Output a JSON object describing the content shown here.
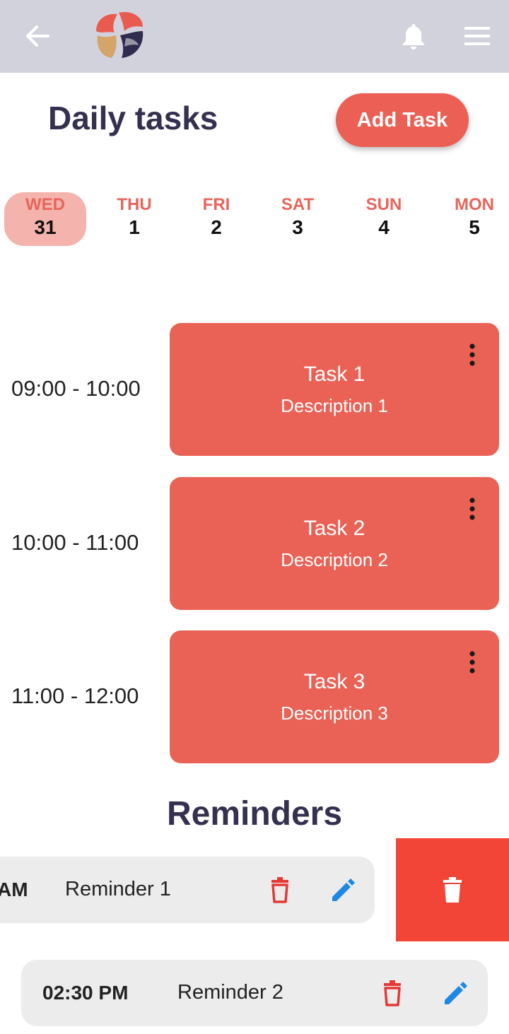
{
  "header": {
    "back_icon": "arrow-left-icon",
    "logo": "app-logo",
    "bell_icon": "bell-icon",
    "menu_icon": "hamburger-menu-icon",
    "background": "#d2d2dd"
  },
  "page": {
    "title": "Daily tasks",
    "add_task_label": "Add Task",
    "accent": "#ec5f55"
  },
  "days": [
    {
      "name": "WED",
      "number": "31",
      "selected": true
    },
    {
      "name": "THU",
      "number": "1",
      "selected": false
    },
    {
      "name": "FRI",
      "number": "2",
      "selected": false
    },
    {
      "name": "SAT",
      "number": "3",
      "selected": false
    },
    {
      "name": "SUN",
      "number": "4",
      "selected": false
    },
    {
      "name": "MON",
      "number": "5",
      "selected": false
    }
  ],
  "tasks": [
    {
      "time": "09:00 - 10:00",
      "name": "Task 1",
      "description": "Description 1"
    },
    {
      "time": "10:00 - 11:00",
      "name": "Task 2",
      "description": "Description 2"
    },
    {
      "time": "11:00 - 12:00",
      "name": "Task 3",
      "description": "Description 3"
    }
  ],
  "reminders_title": "Reminders",
  "reminders": [
    {
      "time": "AM",
      "label": "Reminder 1"
    },
    {
      "time": "02:30 PM",
      "label": "Reminder 2"
    }
  ],
  "colors": {
    "task_card": "#ea6255",
    "delete_red": "#e53935",
    "edit_blue": "#1e88e5",
    "swipe_delete_bg": "#f24437"
  }
}
